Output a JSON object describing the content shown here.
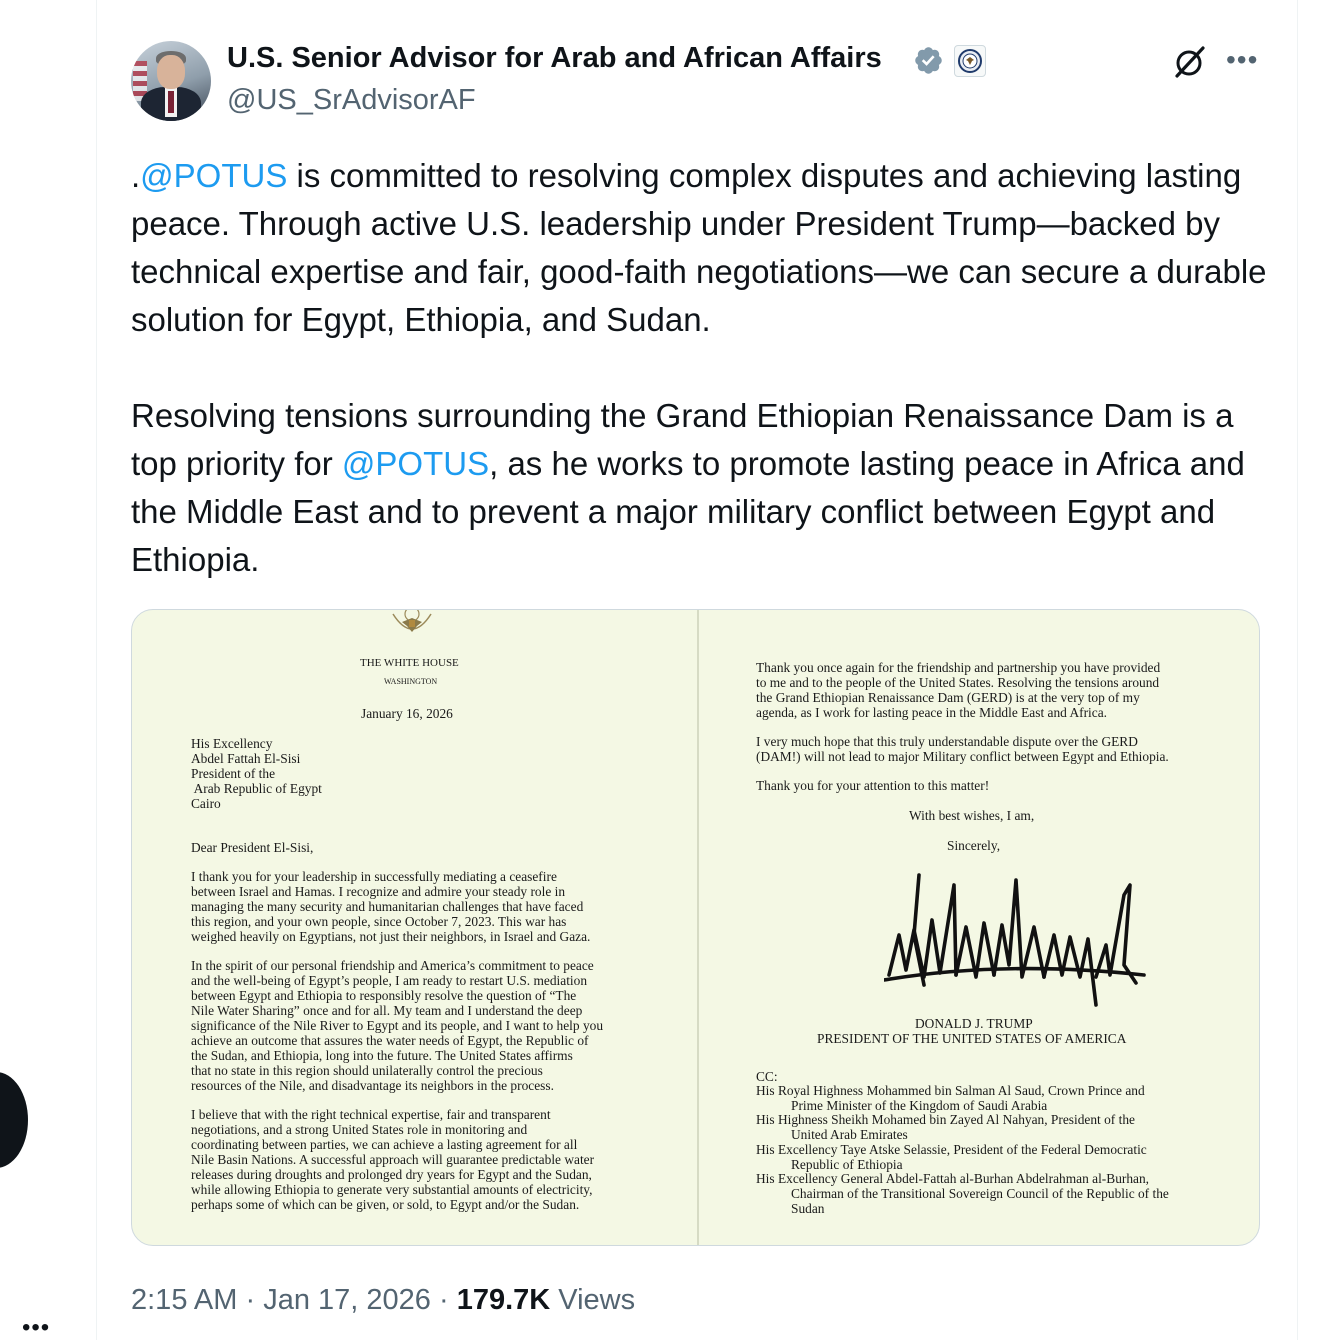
{
  "tweet": {
    "author_name": "U.S. Senior Advisor for Arab and African Affairs",
    "handle": "@US_SrAdvisorAF",
    "para1": [
      {
        "t": "."
      },
      {
        "t": "@POTUS",
        "m": true
      },
      {
        "t": " is committed to resolving complex disputes and achieving lasting peace. Through active U.S. leadership under President Trump—backed by technical expertise and fair, good-faith negotiations—we can secure a durable solution for Egypt, Ethiopia, and Sudan."
      }
    ],
    "para2": [
      {
        "t": "Resolving tensions surrounding the Grand Ethiopian Renaissance Dam is a top priority for "
      },
      {
        "t": "@POTUS",
        "m": true
      },
      {
        "t": ", as he works to promote lasting peace in Africa and the Middle East and to prevent a major military conflict between Egypt and Ethiopia."
      }
    ],
    "time": "2:15 AM",
    "date": "Jan 17, 2026",
    "views_count": "179.7K",
    "views_label": "Views",
    "separator": "·"
  },
  "icons": {
    "verified": "verified-badge-icon",
    "affiliate": "government-seal-icon",
    "grok": "grok-icon",
    "more": "more-options-icon"
  },
  "colors": {
    "mention": "#1d9bf0",
    "verified": "#829aab",
    "muted": "#536471"
  },
  "letter": {
    "left_lines": [
      "THE WHITE HOUSE",
      "WASHINGTON",
      "January 16, 2026",
      "His Excellency",
      "Abdel Fattah El-Sisi",
      "President of the",
      " Arab Republic of Egypt",
      "Cairo",
      "Dear President El-Sisi,",
      "I thank you for your leadership in successfully mediating a ceasefire",
      "between Israel and Hamas. I recognize and admire your steady role in",
      "managing the many security and humanitarian challenges that have faced",
      "this region, and your own people, since October 7, 2023. This war has",
      "weighed heavily on Egyptians, not just their neighbors, in Israel and Gaza.",
      "In the spirit of our personal friendship and America’s commitment to peace",
      "and the well-being of Egypt’s people, I am ready to restart U.S. mediation",
      "between Egypt and Ethiopia to responsibly resolve the question of “The",
      "Nile Water Sharing” once and for all. My team and I understand the deep",
      "significance of the Nile River to Egypt and its people, and I want to help you",
      "achieve an outcome that assures the water needs of Egypt, the Republic of",
      "the Sudan, and Ethiopia, long into the future. The United States affirms",
      "that no state in this region should unilaterally control the precious",
      "resources of the Nile, and disadvantage its neighbors in the process.",
      "I believe that with the right technical expertise, fair and transparent",
      "negotiations, and a strong United States role in monitoring and",
      "coordinating between parties, we can achieve a lasting agreement for all",
      "Nile Basin Nations. A successful approach will guarantee predictable water",
      "releases during droughts and prolonged dry years for Egypt and the Sudan,",
      "while allowing Ethiopia to generate very substantial amounts of electricity,",
      "perhaps some of which can be given, or sold, to Egypt and/or the Sudan."
    ],
    "right_lines": [
      "Thank you once again for the friendship and partnership you have provided",
      "to me and to the people of the United States. Resolving the tensions around",
      "the Grand Ethiopian Renaissance Dam (GERD) is at the very top of my",
      "agenda, as I work for lasting peace in the Middle East and Africa.",
      "I very much hope that this truly understandable dispute over the GERD",
      "(DAM!) will not lead to major Military conflict between Egypt and Ethiopia.",
      "Thank you for your attention to this matter!",
      "With best wishes, I am,",
      "Sincerely,",
      "DONALD J. TRUMP",
      "PRESIDENT OF THE UNITED STATES OF AMERICA",
      "CC:",
      "His Royal Highness Mohammed bin Salman Al Saud, Crown Prince and",
      "Prime Minister of the Kingdom of Saudi Arabia",
      "His Highness Sheikh Mohamed bin Zayed Al Nahyan, President of the",
      "United Arab Emirates",
      "His Excellency Taye Atske Selassie, President of the Federal Democratic",
      "Republic of Ethiopia",
      "His Excellency General Abdel-Fattah al-Burhan Abdelrahman al-Burhan,",
      "Chairman of the Transitional Sovereign Council of the Republic of the",
      "Sudan"
    ]
  }
}
